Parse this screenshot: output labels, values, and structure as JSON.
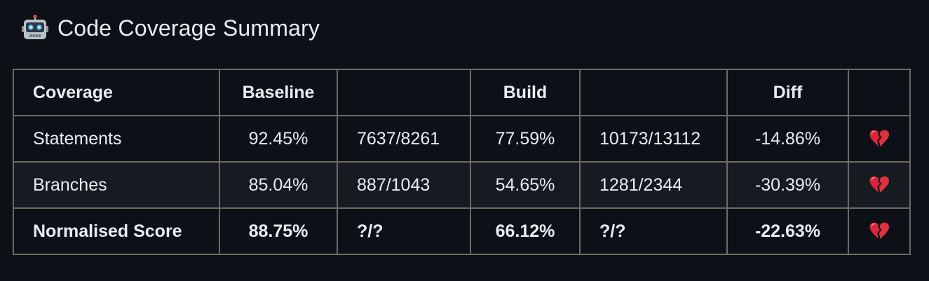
{
  "heading": {
    "icon": "robot-icon",
    "title": "Code Coverage Summary"
  },
  "table": {
    "headers": [
      "Coverage",
      "Baseline",
      "",
      "Build",
      "",
      "Diff",
      ""
    ],
    "rows": [
      {
        "label": "Statements",
        "baseline_pct": "92.45%",
        "baseline_ratio": "7637/8261",
        "build_pct": "77.59%",
        "build_ratio": "10173/13112",
        "diff": "-14.86%",
        "status_icon": "broken-heart-icon"
      },
      {
        "label": "Branches",
        "baseline_pct": "85.04%",
        "baseline_ratio": "887/1043",
        "build_pct": "54.65%",
        "build_ratio": "1281/2344",
        "diff": "-30.39%",
        "status_icon": "broken-heart-icon"
      },
      {
        "label": "Normalised Score",
        "baseline_pct": "88.75%",
        "baseline_ratio": "?/?",
        "build_pct": "66.12%",
        "build_ratio": "?/?",
        "diff": "-22.63%",
        "status_icon": "broken-heart-icon"
      }
    ]
  },
  "colors": {
    "background": "#0d1117",
    "row_alt": "#161b22",
    "border": "#6e6a62",
    "text": "#e6edf3",
    "heart": "#d9263a"
  }
}
